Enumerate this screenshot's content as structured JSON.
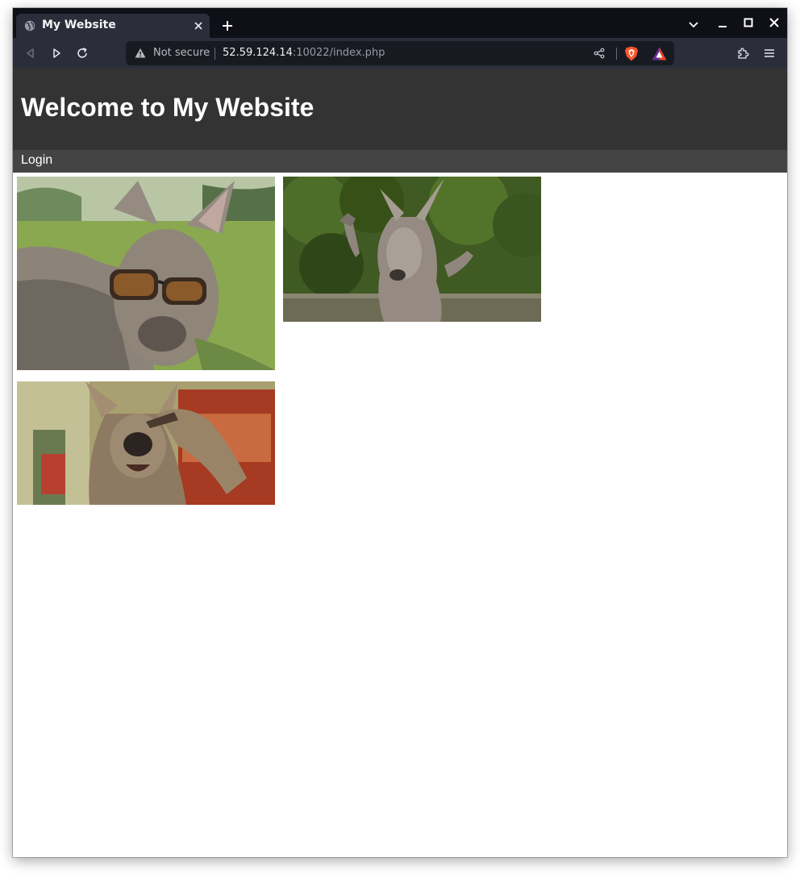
{
  "browser": {
    "tab": {
      "title": "My Website",
      "favicon": "globe-icon"
    },
    "url": {
      "security_label": "Not secure",
      "host": "52.59.124.14",
      "path": ":10022/index.php"
    },
    "colors": {
      "tabstrip": "#0f0f17",
      "toolbar": "#2b2d3a",
      "urlbar": "#181a22"
    }
  },
  "site": {
    "title": "Welcome to My Website",
    "nav": {
      "login_label": "Login"
    },
    "colors": {
      "header_bg": "#333333",
      "nav_bg": "#444444"
    },
    "gallery": [
      {
        "subject": "kangaroo with sunglasses"
      },
      {
        "subject": "kangaroo waving"
      },
      {
        "subject": "kangaroo saluting"
      }
    ]
  }
}
